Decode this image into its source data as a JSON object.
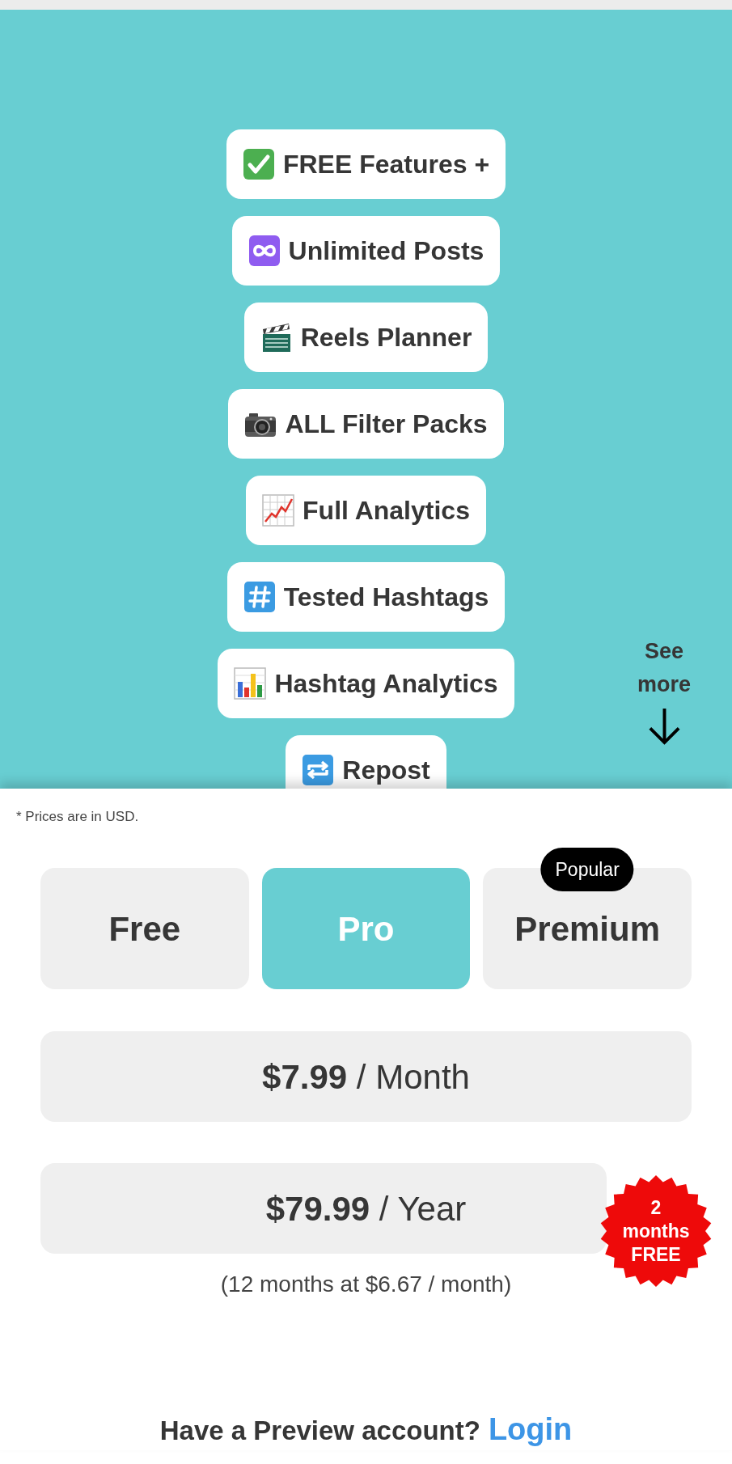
{
  "features": [
    {
      "kind": "check",
      "label": "FREE Features +"
    },
    {
      "kind": "infinity",
      "label": "Unlimited Posts"
    },
    {
      "kind": "clapper",
      "label": "Reels Planner"
    },
    {
      "kind": "camera",
      "label": "ALL Filter Packs"
    },
    {
      "kind": "linechart",
      "label": "Full Analytics"
    },
    {
      "kind": "hash",
      "label": "Tested Hashtags"
    },
    {
      "kind": "barchart",
      "label": "Hashtag Analytics"
    },
    {
      "kind": "repeat",
      "label": "Repost"
    }
  ],
  "see_more": "See more",
  "pricing": {
    "note": "* Prices are in USD.",
    "plans": [
      {
        "label": "Free",
        "selected": false
      },
      {
        "label": "Pro",
        "selected": true
      },
      {
        "label": "Premium",
        "selected": false,
        "badge": "Popular"
      }
    ],
    "options": [
      {
        "price": "**$7.99** / Month"
      },
      {
        "price": "**$79.99** / Year",
        "caption": "(12 months at $6.67 / month)",
        "badge": "2 months FREE"
      }
    ]
  },
  "footer": {
    "prompt": "Have a Preview account?",
    "link": "Login"
  }
}
